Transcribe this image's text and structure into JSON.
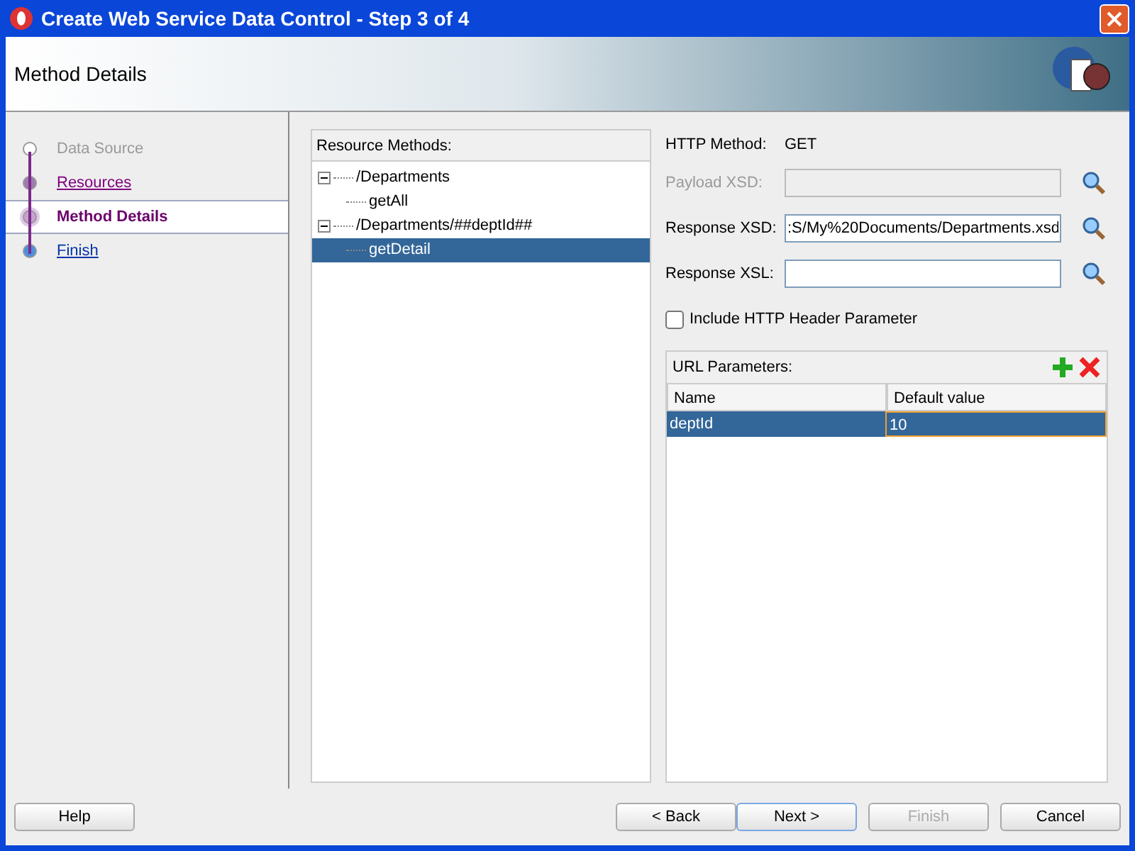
{
  "window": {
    "title": "Create Web Service Data Control - Step 3 of 4"
  },
  "header": {
    "title": "Method Details"
  },
  "steps": [
    {
      "label": "Data Source",
      "kind": "disabled",
      "selected": false
    },
    {
      "label": "Resources",
      "kind": "visited",
      "selected": false
    },
    {
      "label": "Method Details",
      "kind": "current",
      "selected": true
    },
    {
      "label": "Finish",
      "kind": "link",
      "selected": false
    }
  ],
  "resource_methods": {
    "title": "Resource Methods:",
    "tree": [
      {
        "label": "/Departments",
        "expanded": true,
        "selected": false,
        "children": [
          {
            "label": "getAll",
            "selected": false
          }
        ]
      },
      {
        "label": "/Departments/##deptId##",
        "expanded": true,
        "selected": false,
        "children": [
          {
            "label": "getDetail",
            "selected": true
          }
        ]
      }
    ]
  },
  "form": {
    "http_method_label": "HTTP Method:",
    "http_method": "GET",
    "fields": [
      {
        "label": "Payload XSD:",
        "disabled": true
      },
      {
        "label": "Response XSD:",
        "value": ":S/My%20Documents/Departments.xsd",
        "disabled": false
      },
      {
        "label": "Response XSL:",
        "disabled": false
      }
    ],
    "include_header": {
      "label": "Include HTTP Header Parameter",
      "checked": false
    }
  },
  "url_parameters": {
    "title": "URL Parameters:",
    "columns": [
      "Name",
      "Default value"
    ],
    "rows": [
      {
        "cells": [
          "deptId",
          "10"
        ],
        "selected": true
      }
    ]
  },
  "buttons": [
    {
      "label": "Help",
      "disabled": false,
      "default": false
    },
    {
      "label": "< Back",
      "disabled": false,
      "default": false
    },
    {
      "label": "Next >",
      "disabled": false,
      "default": true
    },
    {
      "label": "Finish",
      "disabled": true,
      "default": false
    },
    {
      "label": "Cancel",
      "disabled": false,
      "default": false
    }
  ]
}
